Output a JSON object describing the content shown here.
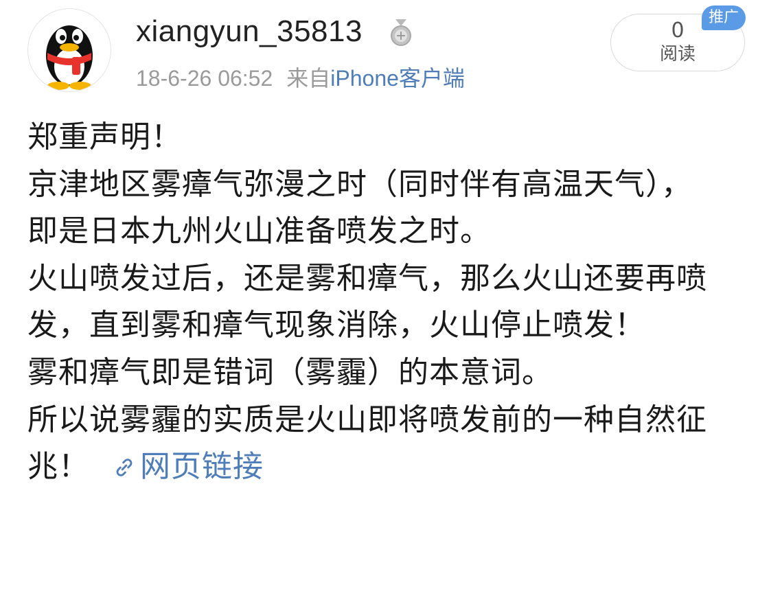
{
  "user": {
    "name": "xiangyun_35813",
    "avatar": "qq-penguin-avatar",
    "badge_icon": "medal-icon"
  },
  "meta": {
    "time": "18-6-26 06:52",
    "source_prefix": "来自",
    "source_link": "iPhone客户端"
  },
  "stats": {
    "read_count": "0",
    "read_label": "阅读",
    "promo_badge": "推广"
  },
  "content": {
    "lines": [
      "郑重声明！",
      "京津地区雾瘴气弥漫之时（同时伴有高温天气），",
      "即是日本九州火山准备喷发之时。",
      "火山喷发过后，还是雾和瘴气，那么火山还要再喷发，直到雾和瘴气现象消除，火山停止喷发！",
      "雾和瘴气即是错词（雾霾）的本意词。",
      "所以说雾霾的实质是火山即将喷发前的一种自然征兆！"
    ],
    "link_label": "网页链接",
    "link_icon": "link-icon"
  },
  "colors": {
    "link_blue": "#4f7db8",
    "meta_gray": "#9a9a9a",
    "badge_blue": "#5b9be6"
  }
}
